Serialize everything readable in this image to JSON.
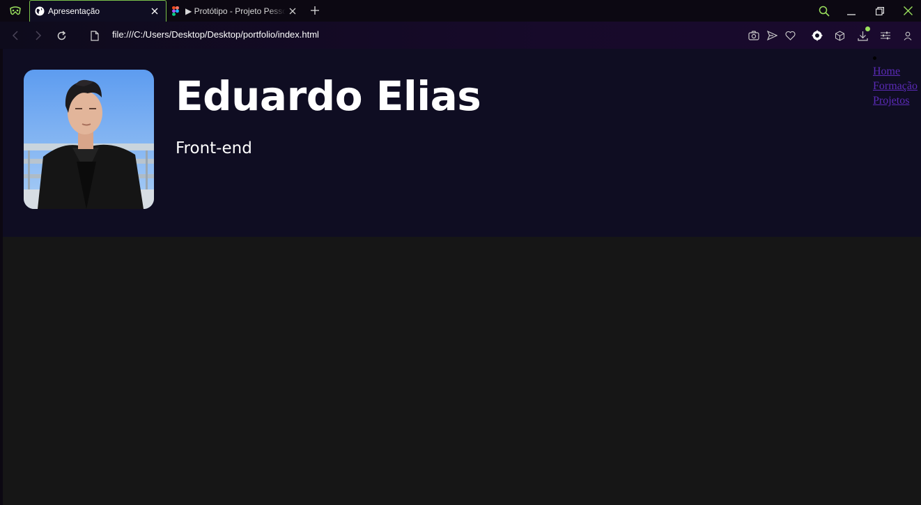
{
  "browser": {
    "tabs": [
      {
        "title": "Apresentação",
        "active": true,
        "icon": "globe-icon"
      },
      {
        "title": "▶ Protótipo - Projeto Pessoal",
        "active": false,
        "icon": "figma-icon"
      }
    ],
    "url": "file:///C:/Users/Desktop/Desktop/portfolio/index.html",
    "accent_color": "#9be15d"
  },
  "page": {
    "name": "Eduardo Elias",
    "role": "Front-end",
    "nav": [
      {
        "label": "Home"
      },
      {
        "label": "Formação"
      },
      {
        "label": "Projetos"
      }
    ],
    "header_bg": "#0f0d22",
    "body_bg": "#161616",
    "link_color": "#5b2bb8"
  }
}
